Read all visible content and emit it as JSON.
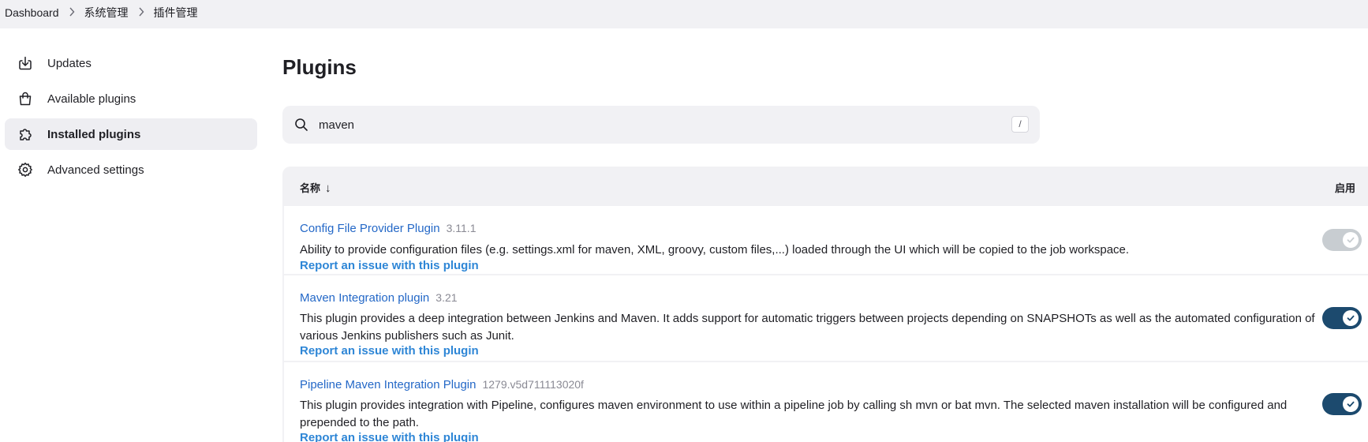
{
  "breadcrumb": [
    "Dashboard",
    "系统管理",
    "插件管理"
  ],
  "sidebar": {
    "items": [
      {
        "label": "Updates",
        "icon": "download-icon"
      },
      {
        "label": "Available plugins",
        "icon": "shopping-bag-icon"
      },
      {
        "label": "Installed plugins",
        "icon": "puzzle-icon",
        "active": true
      },
      {
        "label": "Advanced settings",
        "icon": "gear-icon"
      }
    ]
  },
  "page": {
    "title": "Plugins"
  },
  "search": {
    "value": "maven",
    "shortcut": "/"
  },
  "table": {
    "col_name": "名称",
    "sort_arrow": "↓",
    "col_enabled": "启用",
    "rows": [
      {
        "name": "Config File Provider Plugin",
        "version": "3.11.1",
        "description": "Ability to provide configuration files (e.g. settings.xml for maven, XML, groovy, custom files,...) loaded through the UI which will be copied to the job workspace.",
        "report": "Report an issue with this plugin",
        "enabled": true,
        "toggle_disabled": true
      },
      {
        "name": "Maven Integration plugin",
        "version": "3.21",
        "description": "This plugin provides a deep integration between Jenkins and Maven. It adds support for automatic triggers between projects depending on SNAPSHOTs as well as the automated configuration of various Jenkins publishers such as Junit.",
        "report": "Report an issue with this plugin",
        "enabled": true,
        "toggle_disabled": false
      },
      {
        "name": "Pipeline Maven Integration Plugin",
        "version": "1279.v5d711113020f",
        "description": "This plugin provides integration with Pipeline, configures maven environment to use within a pipeline job by calling sh mvn or bat mvn. The selected maven installation will be configured and prepended to the path.",
        "report": "Report an issue with this plugin",
        "enabled": true,
        "toggle_disabled": false
      }
    ]
  },
  "colors": {
    "link": "#2468c7",
    "report_link": "#2e86d6",
    "toggle_on": "#1c4a6e",
    "toggle_disabled": "#c8cdd1"
  }
}
